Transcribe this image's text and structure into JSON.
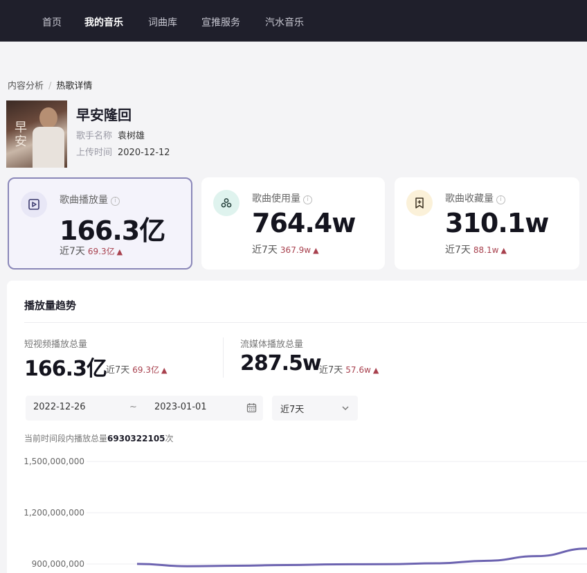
{
  "nav": {
    "items": [
      "首页",
      "我的音乐",
      "词曲库",
      "宣推服务",
      "汽水音乐"
    ],
    "active_index": 1
  },
  "breadcrumb": {
    "parent": "内容分析",
    "separator": "/",
    "current": "热歌详情"
  },
  "song": {
    "title": "早安隆回",
    "singer_label": "歌手名称",
    "singer": "袁树雄",
    "upload_label": "上传时间",
    "upload_date": "2020-12-12"
  },
  "stats": [
    {
      "label": "歌曲播放量",
      "value": "166.3亿",
      "period": "近7天",
      "delta": "69.3亿",
      "icon": "play-video-icon",
      "icon_bg": "#e8e7f6",
      "active": true
    },
    {
      "label": "歌曲使用量",
      "value": "764.4w",
      "period": "近7天",
      "delta": "367.9w",
      "icon": "usage-circles-icon",
      "icon_bg": "#dff3ee",
      "active": false
    },
    {
      "label": "歌曲收藏量",
      "value": "310.1w",
      "period": "近7天",
      "delta": "88.1w",
      "icon": "bookmark-plus-icon",
      "icon_bg": "#fbf1d9",
      "active": false
    }
  ],
  "trend": {
    "title": "播放量趋势",
    "short_video": {
      "label": "短视频播放总量",
      "value": "166.3亿",
      "period": "近7天",
      "delta": "69.3亿"
    },
    "streaming": {
      "label": "流媒体播放总量",
      "value": "287.5w",
      "period": "近7天",
      "delta": "57.6w"
    },
    "date_start": "2022-12-26",
    "date_sep": "~",
    "date_end": "2023-01-01",
    "period_option": "近7天",
    "total_prefix": "当前时间段内播放总量",
    "total_value": "6930322105",
    "total_suffix": "次"
  },
  "colors": {
    "accent": "#6c63b0",
    "delta": "#a8414e",
    "nav_bg": "#1f1f2b"
  },
  "chart_data": {
    "type": "line",
    "y_ticks": [
      "1,500,000,000",
      "1,200,000,000",
      "900,000,000"
    ],
    "ylim": [
      900000000,
      1500000000
    ],
    "series": [
      {
        "values": [
          900500000,
          887000000,
          890000000,
          894000000,
          898000000,
          899000000,
          904000000,
          919000000,
          946000000,
          990000000
        ]
      }
    ],
    "grid": true,
    "legend": "none"
  }
}
